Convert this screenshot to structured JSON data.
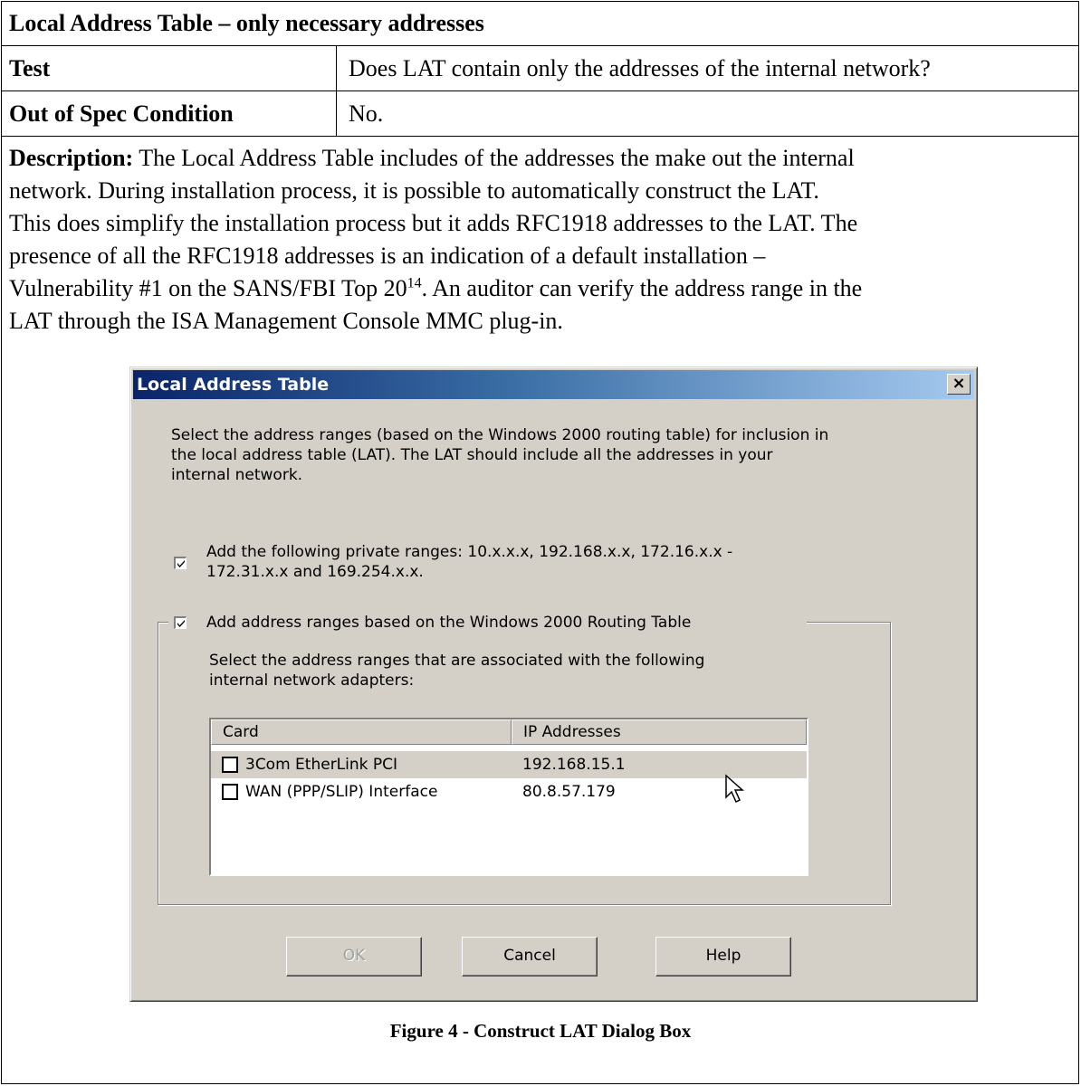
{
  "table": {
    "heading": "Local Address Table – only necessary addresses",
    "test_label": "Test",
    "test_value": "Does LAT contain only the addresses of the internal network?",
    "oos_label": "Out of Spec Condition",
    "oos_value": "No."
  },
  "description": {
    "label": "Description:",
    "line1": " The Local Address Table includes of the addresses the make out the internal",
    "line2": "network.  During installation process, it is possible to automatically construct the LAT.",
    "line3": "This does simplify the installation process but it adds RFC1918 addresses to the LAT.  The",
    "line4": "presence of all the RFC1918 addresses is an indication of a default installation –",
    "line5a": "Vulnerability #1 on the SANS/FBI Top 20",
    "footnote": "14",
    "line5b": ". An auditor can verify the address range in the",
    "line6": "LAT through the ISA Management Console MMC plug-in."
  },
  "dialog": {
    "title": "Local Address Table",
    "close_glyph": "×",
    "intro1": "Select the address ranges (based on the Windows 2000 routing table) for inclusion in",
    "intro2": "the local address table (LAT). The LAT should include all the addresses in your",
    "intro3": "internal network.",
    "private_ranges_1": "Add the following private ranges: 10.x.x.x, 192.168.x.x, 172.16.x.x -",
    "private_ranges_2": "172.31.x.x and 169.254.x.x.",
    "private_ranges_checked": true,
    "routing_label": "Add address ranges based on the Windows 2000 Routing Table",
    "routing_checked": true,
    "adapters_1": "Select the address ranges that are associated with the following",
    "adapters_2": "internal network adapters:",
    "columns": [
      "Card",
      "IP Addresses"
    ],
    "rows": [
      {
        "card": "3Com EtherLink PCI",
        "ip": "192.168.15.1",
        "checked": false,
        "selected": true
      },
      {
        "card": "WAN (PPP/SLIP) Interface",
        "ip": "80.8.57.179",
        "checked": false,
        "selected": false
      }
    ],
    "ok_label": "OK",
    "cancel_label": "Cancel",
    "help_label": "Help"
  },
  "caption": "Figure 4 - Construct LAT Dialog Box"
}
